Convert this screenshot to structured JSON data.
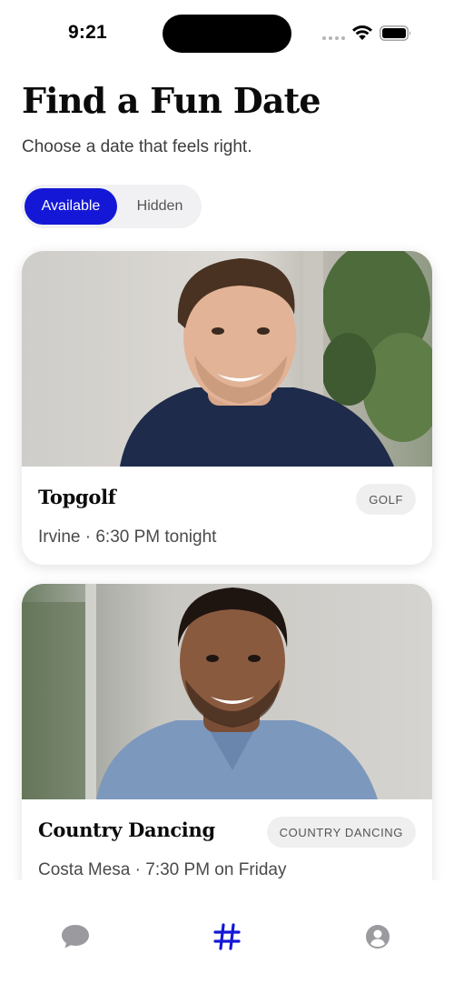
{
  "status_bar": {
    "time": "9:21"
  },
  "header": {
    "title": "Find a Fun Date",
    "subtitle": "Choose a date that feels right."
  },
  "segmented_control": {
    "options": [
      "Available",
      "Hidden"
    ],
    "selected": "Available"
  },
  "cards": [
    {
      "title": "Topgolf",
      "tag": "GOLF",
      "meta": "Irvine · 6:30 PM tonight",
      "photo": "man-dark-sweater-icon"
    },
    {
      "title": "Country Dancing",
      "tag": "COUNTRY DANCING",
      "meta": "Costa Mesa · 7:30 PM on Friday",
      "photo": "man-blue-shirt-icon"
    }
  ],
  "tab_bar": {
    "items": [
      {
        "icon": "chat-bubble-icon",
        "active": false
      },
      {
        "icon": "hashtag-icon",
        "active": true
      },
      {
        "icon": "profile-icon",
        "active": false
      }
    ]
  },
  "colors": {
    "accent": "#1418d6",
    "inactive_icon": "#9a9a9f",
    "tag_background": "#efefef"
  }
}
